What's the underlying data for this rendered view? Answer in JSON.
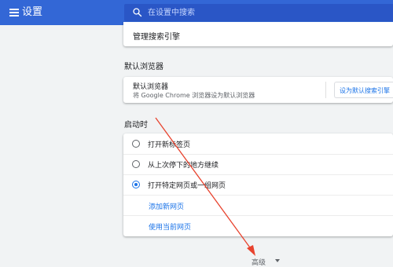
{
  "app": {
    "title": "设置"
  },
  "search": {
    "placeholder": "在设置中搜索",
    "icon": "search-icon"
  },
  "search_engine": {
    "manage_label": "管理搜索引擎"
  },
  "default_browser": {
    "section_title": "默认浏览器",
    "title": "默认浏览器",
    "subtitle": "将 Google Chrome 浏览器设为默认浏览器",
    "button_label": "设为默认搜索引擎"
  },
  "startup": {
    "section_title": "启动时",
    "options": [
      {
        "label": "打开新标签页",
        "checked": false
      },
      {
        "label": "从上次停下的地方继续",
        "checked": false
      },
      {
        "label": "打开特定网页或一组网页",
        "checked": true
      }
    ],
    "links": [
      "添加新网页",
      "使用当前网页"
    ]
  },
  "advanced": {
    "label": "高级"
  },
  "colors": {
    "topbar": "#3367d6",
    "search_bg": "#2a56c6",
    "accent": "#1a73e8",
    "annotation_arrow": "#e8432e"
  }
}
